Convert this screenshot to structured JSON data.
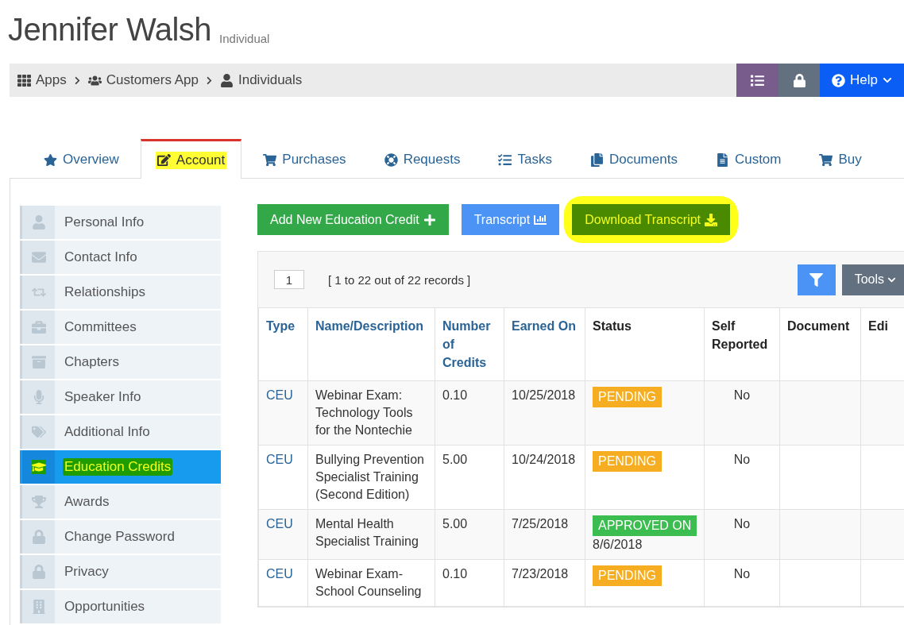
{
  "page_title": {
    "name": "Jennifer Walsh",
    "subtitle": "Individual"
  },
  "breadcrumb": [
    "Apps",
    "Customers App",
    "Individuals"
  ],
  "toolbar": {
    "help_label": "Help"
  },
  "tabs": [
    {
      "label": "Overview",
      "selected": false,
      "highlighted": false
    },
    {
      "label": "Account",
      "selected": true,
      "highlighted": true
    },
    {
      "label": "Purchases",
      "selected": false,
      "highlighted": false
    },
    {
      "label": "Requests",
      "selected": false,
      "highlighted": false
    },
    {
      "label": "Tasks",
      "selected": false,
      "highlighted": false
    },
    {
      "label": "Documents",
      "selected": false,
      "highlighted": false
    },
    {
      "label": "Custom",
      "selected": false,
      "highlighted": false
    },
    {
      "label": "Buy",
      "selected": false,
      "highlighted": false
    }
  ],
  "sidebar": {
    "items": [
      {
        "label": "Personal Info",
        "selected": false,
        "highlighted": false
      },
      {
        "label": "Contact Info",
        "selected": false,
        "highlighted": false
      },
      {
        "label": "Relationships",
        "selected": false,
        "highlighted": false
      },
      {
        "label": "Committees",
        "selected": false,
        "highlighted": false
      },
      {
        "label": "Chapters",
        "selected": false,
        "highlighted": false
      },
      {
        "label": "Speaker Info",
        "selected": false,
        "highlighted": false
      },
      {
        "label": "Additional Info",
        "selected": false,
        "highlighted": false
      },
      {
        "label": "Education Credits",
        "selected": true,
        "highlighted": true
      },
      {
        "label": "Awards",
        "selected": false,
        "highlighted": false
      },
      {
        "label": "Change Password",
        "selected": false,
        "highlighted": false
      },
      {
        "label": "Privacy",
        "selected": false,
        "highlighted": false
      },
      {
        "label": "Opportunities",
        "selected": false,
        "highlighted": false
      }
    ]
  },
  "actions": [
    {
      "label": "Add New Education Credit",
      "kind": "add",
      "highlighted": false
    },
    {
      "label": "Transcript",
      "kind": "chart",
      "highlighted": false
    },
    {
      "label": "Download Transcript",
      "kind": "download",
      "highlighted": true
    }
  ],
  "table": {
    "page": "1",
    "records": "[ 1 to 22 out of 22 records ]",
    "tools_label": "Tools",
    "columns": [
      {
        "label": "Type",
        "sortable": true
      },
      {
        "label": "Name/Description",
        "sortable": true
      },
      {
        "label": "Number of Credits",
        "sortable": true
      },
      {
        "label": "Earned On",
        "sortable": true
      },
      {
        "label": "Status",
        "sortable": false
      },
      {
        "label": "Self Reported",
        "sortable": false
      },
      {
        "label": "Document",
        "sortable": false
      },
      {
        "label": "Edi",
        "sortable": false
      }
    ],
    "rows": [
      {
        "type": "CEU",
        "name": "Webinar Exam: Technology Tools for the Nontechie",
        "credits": "0.10",
        "earned": "10/25/2018",
        "status": {
          "kind": "pending",
          "label": "PENDING"
        },
        "self_reported": "No"
      },
      {
        "type": "CEU",
        "name": "Bullying Prevention Specialist Training (Second Edition)",
        "credits": "5.00",
        "earned": "10/24/2018",
        "status": {
          "kind": "pending",
          "label": "PENDING"
        },
        "self_reported": "No"
      },
      {
        "type": "CEU",
        "name": "Mental Health Specialist Training",
        "credits": "5.00",
        "earned": "7/25/2018",
        "status": {
          "kind": "approved",
          "label": "APPROVED ON",
          "detail": "8/6/2018"
        },
        "self_reported": "No"
      },
      {
        "type": "CEU",
        "name": "Webinar Exam-School Counseling",
        "credits": "0.10",
        "earned": "7/23/2018",
        "status": {
          "kind": "pending",
          "label": "PENDING"
        },
        "self_reported": "No"
      }
    ]
  }
}
